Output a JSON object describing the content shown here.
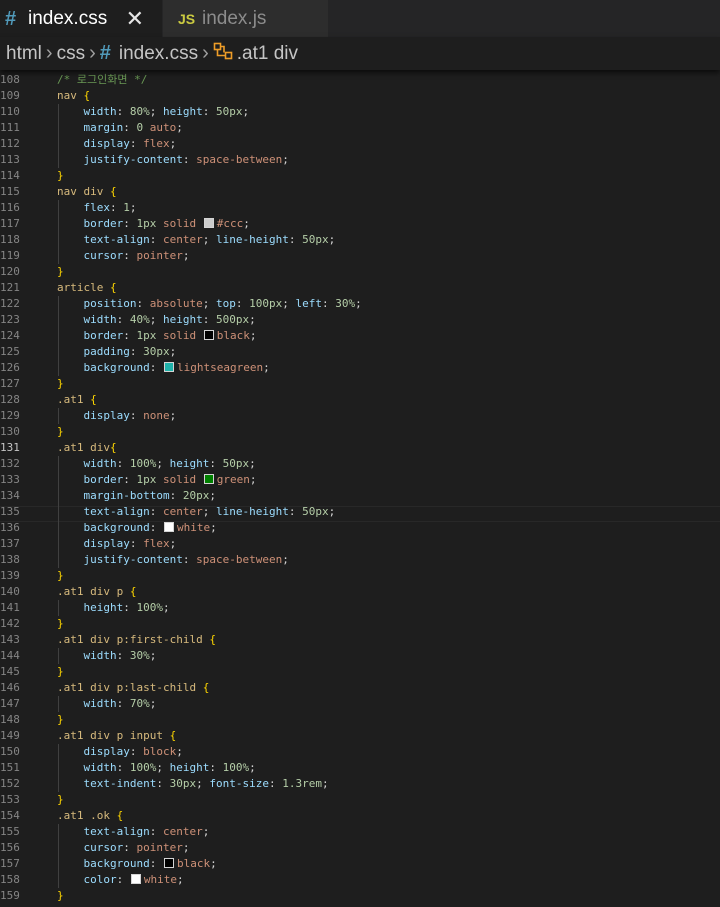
{
  "tabs": [
    {
      "icon": "#",
      "label": "index.css"
    },
    {
      "icon": "JS",
      "label": "index.js"
    }
  ],
  "tab_close": "✕",
  "breadcrumb": {
    "items": [
      "html",
      "css",
      "index.css",
      ".at1 div"
    ],
    "sep": "›",
    "hash": "#"
  },
  "colors": {
    "ccc": "#cccccc",
    "black": "#000000",
    "lightseagreen": "#20b2aa",
    "green": "#008000",
    "white": "#ffffff"
  },
  "current_line": 131,
  "lines": [
    {
      "n": 108,
      "i": 0,
      "t": [
        [
          "c",
          "/* 로그인화면 */"
        ]
      ]
    },
    {
      "n": 109,
      "i": 0,
      "t": [
        [
          "s",
          "nav "
        ],
        [
          "b",
          "{"
        ]
      ]
    },
    {
      "n": 110,
      "i": 1,
      "t": [
        [
          "p",
          "width"
        ],
        [
          "u",
          ": "
        ],
        [
          "n",
          "80%"
        ],
        [
          "u",
          "; "
        ],
        [
          "p",
          "height"
        ],
        [
          "u",
          ": "
        ],
        [
          "n",
          "50px"
        ],
        [
          "u",
          ";"
        ]
      ]
    },
    {
      "n": 111,
      "i": 1,
      "t": [
        [
          "p",
          "margin"
        ],
        [
          "u",
          ": "
        ],
        [
          "n",
          "0"
        ],
        [
          "u",
          " "
        ],
        [
          "v",
          "auto"
        ],
        [
          "u",
          ";"
        ]
      ]
    },
    {
      "n": 112,
      "i": 1,
      "t": [
        [
          "p",
          "display"
        ],
        [
          "u",
          ": "
        ],
        [
          "v",
          "flex"
        ],
        [
          "u",
          ";"
        ]
      ]
    },
    {
      "n": 113,
      "i": 1,
      "t": [
        [
          "p",
          "justify-content"
        ],
        [
          "u",
          ": "
        ],
        [
          "v",
          "space-between"
        ],
        [
          "u",
          ";"
        ]
      ]
    },
    {
      "n": 114,
      "i": 0,
      "t": [
        [
          "b",
          "}"
        ]
      ]
    },
    {
      "n": 115,
      "i": 0,
      "t": [
        [
          "s",
          "nav div "
        ],
        [
          "b",
          "{"
        ]
      ]
    },
    {
      "n": 116,
      "i": 1,
      "t": [
        [
          "p",
          "flex"
        ],
        [
          "u",
          ": "
        ],
        [
          "n",
          "1"
        ],
        [
          "u",
          ";"
        ]
      ]
    },
    {
      "n": 117,
      "i": 1,
      "t": [
        [
          "p",
          "border"
        ],
        [
          "u",
          ": "
        ],
        [
          "n",
          "1px"
        ],
        [
          "u",
          " "
        ],
        [
          "v",
          "solid "
        ],
        [
          "w",
          "ccc"
        ],
        [
          "v",
          "#ccc"
        ],
        [
          "u",
          ";"
        ]
      ]
    },
    {
      "n": 118,
      "i": 1,
      "t": [
        [
          "p",
          "text-align"
        ],
        [
          "u",
          ": "
        ],
        [
          "v",
          "center"
        ],
        [
          "u",
          "; "
        ],
        [
          "p",
          "line-height"
        ],
        [
          "u",
          ": "
        ],
        [
          "n",
          "50px"
        ],
        [
          "u",
          ";"
        ]
      ]
    },
    {
      "n": 119,
      "i": 1,
      "t": [
        [
          "p",
          "cursor"
        ],
        [
          "u",
          ": "
        ],
        [
          "v",
          "pointer"
        ],
        [
          "u",
          ";"
        ]
      ]
    },
    {
      "n": 120,
      "i": 0,
      "t": [
        [
          "b",
          "}"
        ]
      ]
    },
    {
      "n": 121,
      "i": 0,
      "t": [
        [
          "s",
          "article "
        ],
        [
          "b",
          "{"
        ]
      ]
    },
    {
      "n": 122,
      "i": 1,
      "t": [
        [
          "p",
          "position"
        ],
        [
          "u",
          ": "
        ],
        [
          "v",
          "absolute"
        ],
        [
          "u",
          "; "
        ],
        [
          "p",
          "top"
        ],
        [
          "u",
          ": "
        ],
        [
          "n",
          "100px"
        ],
        [
          "u",
          "; "
        ],
        [
          "p",
          "left"
        ],
        [
          "u",
          ": "
        ],
        [
          "n",
          "30%"
        ],
        [
          "u",
          ";"
        ]
      ]
    },
    {
      "n": 123,
      "i": 1,
      "t": [
        [
          "p",
          "width"
        ],
        [
          "u",
          ": "
        ],
        [
          "n",
          "40%"
        ],
        [
          "u",
          "; "
        ],
        [
          "p",
          "height"
        ],
        [
          "u",
          ": "
        ],
        [
          "n",
          "500px"
        ],
        [
          "u",
          ";"
        ]
      ]
    },
    {
      "n": 124,
      "i": 1,
      "t": [
        [
          "p",
          "border"
        ],
        [
          "u",
          ": "
        ],
        [
          "n",
          "1px"
        ],
        [
          "u",
          " "
        ],
        [
          "v",
          "solid "
        ],
        [
          "w",
          "black"
        ],
        [
          "v",
          "black"
        ],
        [
          "u",
          ";"
        ]
      ]
    },
    {
      "n": 125,
      "i": 1,
      "t": [
        [
          "p",
          "padding"
        ],
        [
          "u",
          ": "
        ],
        [
          "n",
          "30px"
        ],
        [
          "u",
          ";"
        ]
      ]
    },
    {
      "n": 126,
      "i": 1,
      "t": [
        [
          "p",
          "background"
        ],
        [
          "u",
          ": "
        ],
        [
          "w",
          "lightseagreen"
        ],
        [
          "v",
          "lightseagreen"
        ],
        [
          "u",
          ";"
        ]
      ]
    },
    {
      "n": 127,
      "i": 0,
      "t": [
        [
          "b",
          "}"
        ]
      ]
    },
    {
      "n": 128,
      "i": 0,
      "t": [
        [
          "s",
          ".at1 "
        ],
        [
          "b",
          "{"
        ]
      ]
    },
    {
      "n": 129,
      "i": 1,
      "t": [
        [
          "p",
          "display"
        ],
        [
          "u",
          ": "
        ],
        [
          "v",
          "none"
        ],
        [
          "u",
          ";"
        ]
      ]
    },
    {
      "n": 130,
      "i": 0,
      "t": [
        [
          "b",
          "}"
        ]
      ]
    },
    {
      "n": 131,
      "i": 0,
      "t": [
        [
          "s",
          ".at1 div"
        ],
        [
          "b",
          "{"
        ]
      ]
    },
    {
      "n": 132,
      "i": 1,
      "t": [
        [
          "p",
          "width"
        ],
        [
          "u",
          ": "
        ],
        [
          "n",
          "100%"
        ],
        [
          "u",
          "; "
        ],
        [
          "p",
          "height"
        ],
        [
          "u",
          ": "
        ],
        [
          "n",
          "50px"
        ],
        [
          "u",
          ";"
        ]
      ]
    },
    {
      "n": 133,
      "i": 1,
      "t": [
        [
          "p",
          "border"
        ],
        [
          "u",
          ": "
        ],
        [
          "n",
          "1px"
        ],
        [
          "u",
          " "
        ],
        [
          "v",
          "solid "
        ],
        [
          "w",
          "green"
        ],
        [
          "v",
          "green"
        ],
        [
          "u",
          ";"
        ]
      ]
    },
    {
      "n": 134,
      "i": 1,
      "t": [
        [
          "p",
          "margin-bottom"
        ],
        [
          "u",
          ": "
        ],
        [
          "n",
          "20px"
        ],
        [
          "u",
          ";"
        ]
      ]
    },
    {
      "n": 135,
      "i": 1,
      "t": [
        [
          "p",
          "text-align"
        ],
        [
          "u",
          ": "
        ],
        [
          "v",
          "center"
        ],
        [
          "u",
          "; "
        ],
        [
          "p",
          "line-height"
        ],
        [
          "u",
          ": "
        ],
        [
          "n",
          "50px"
        ],
        [
          "u",
          ";"
        ]
      ]
    },
    {
      "n": 136,
      "i": 1,
      "t": [
        [
          "p",
          "background"
        ],
        [
          "u",
          ": "
        ],
        [
          "w",
          "white"
        ],
        [
          "v",
          "white"
        ],
        [
          "u",
          ";"
        ]
      ]
    },
    {
      "n": 137,
      "i": 1,
      "t": [
        [
          "p",
          "display"
        ],
        [
          "u",
          ": "
        ],
        [
          "v",
          "flex"
        ],
        [
          "u",
          ";"
        ]
      ]
    },
    {
      "n": 138,
      "i": 1,
      "t": [
        [
          "p",
          "justify-content"
        ],
        [
          "u",
          ": "
        ],
        [
          "v",
          "space-between"
        ],
        [
          "u",
          ";"
        ]
      ]
    },
    {
      "n": 139,
      "i": 0,
      "t": [
        [
          "b",
          "}"
        ]
      ]
    },
    {
      "n": 140,
      "i": 0,
      "t": [
        [
          "s",
          ".at1 div p "
        ],
        [
          "b",
          "{"
        ]
      ]
    },
    {
      "n": 141,
      "i": 1,
      "t": [
        [
          "p",
          "height"
        ],
        [
          "u",
          ": "
        ],
        [
          "n",
          "100%"
        ],
        [
          "u",
          ";"
        ]
      ]
    },
    {
      "n": 142,
      "i": 0,
      "t": [
        [
          "b",
          "}"
        ]
      ]
    },
    {
      "n": 143,
      "i": 0,
      "t": [
        [
          "s",
          ".at1 div p:first-child "
        ],
        [
          "b",
          "{"
        ]
      ]
    },
    {
      "n": 144,
      "i": 1,
      "t": [
        [
          "p",
          "width"
        ],
        [
          "u",
          ": "
        ],
        [
          "n",
          "30%"
        ],
        [
          "u",
          ";"
        ]
      ]
    },
    {
      "n": 145,
      "i": 0,
      "t": [
        [
          "b",
          "}"
        ]
      ]
    },
    {
      "n": 146,
      "i": 0,
      "t": [
        [
          "s",
          ".at1 div p:last-child "
        ],
        [
          "b",
          "{"
        ]
      ]
    },
    {
      "n": 147,
      "i": 1,
      "t": [
        [
          "p",
          "width"
        ],
        [
          "u",
          ": "
        ],
        [
          "n",
          "70%"
        ],
        [
          "u",
          ";"
        ]
      ]
    },
    {
      "n": 148,
      "i": 0,
      "t": [
        [
          "b",
          "}"
        ]
      ]
    },
    {
      "n": 149,
      "i": 0,
      "t": [
        [
          "s",
          ".at1 div p input "
        ],
        [
          "b",
          "{"
        ]
      ]
    },
    {
      "n": 150,
      "i": 1,
      "t": [
        [
          "p",
          "display"
        ],
        [
          "u",
          ": "
        ],
        [
          "v",
          "block"
        ],
        [
          "u",
          ";"
        ]
      ]
    },
    {
      "n": 151,
      "i": 1,
      "t": [
        [
          "p",
          "width"
        ],
        [
          "u",
          ": "
        ],
        [
          "n",
          "100%"
        ],
        [
          "u",
          "; "
        ],
        [
          "p",
          "height"
        ],
        [
          "u",
          ": "
        ],
        [
          "n",
          "100%"
        ],
        [
          "u",
          ";"
        ]
      ]
    },
    {
      "n": 152,
      "i": 1,
      "t": [
        [
          "p",
          "text-indent"
        ],
        [
          "u",
          ": "
        ],
        [
          "n",
          "30px"
        ],
        [
          "u",
          "; "
        ],
        [
          "p",
          "font-size"
        ],
        [
          "u",
          ": "
        ],
        [
          "n",
          "1.3rem"
        ],
        [
          "u",
          ";"
        ]
      ]
    },
    {
      "n": 153,
      "i": 0,
      "t": [
        [
          "b",
          "}"
        ]
      ]
    },
    {
      "n": 154,
      "i": 0,
      "t": [
        [
          "s",
          ".at1 .ok "
        ],
        [
          "b",
          "{"
        ]
      ]
    },
    {
      "n": 155,
      "i": 1,
      "t": [
        [
          "p",
          "text-align"
        ],
        [
          "u",
          ": "
        ],
        [
          "v",
          "center"
        ],
        [
          "u",
          ";"
        ]
      ]
    },
    {
      "n": 156,
      "i": 1,
      "t": [
        [
          "p",
          "cursor"
        ],
        [
          "u",
          ": "
        ],
        [
          "v",
          "pointer"
        ],
        [
          "u",
          ";"
        ]
      ]
    },
    {
      "n": 157,
      "i": 1,
      "t": [
        [
          "p",
          "background"
        ],
        [
          "u",
          ": "
        ],
        [
          "w",
          "black"
        ],
        [
          "v",
          "black"
        ],
        [
          "u",
          ";"
        ]
      ]
    },
    {
      "n": 158,
      "i": 1,
      "t": [
        [
          "p",
          "color"
        ],
        [
          "u",
          ": "
        ],
        [
          "w",
          "white"
        ],
        [
          "v",
          "white"
        ],
        [
          "u",
          ";"
        ]
      ]
    },
    {
      "n": 159,
      "i": 0,
      "t": [
        [
          "b",
          "}"
        ]
      ]
    }
  ]
}
